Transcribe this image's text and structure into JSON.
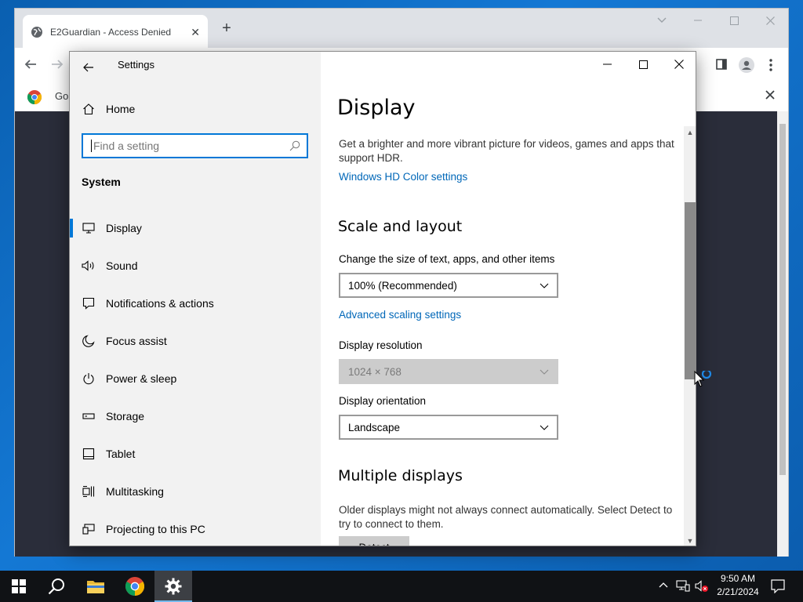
{
  "browser": {
    "tab_title": "E2Guardian - Access Denied",
    "bookmark_text": "Go"
  },
  "settings": {
    "window_title": "Settings",
    "home_label": "Home",
    "search_placeholder": "Find a setting",
    "section_label": "System",
    "nav_items": [
      {
        "label": "Display",
        "icon": "monitor-icon",
        "active": true
      },
      {
        "label": "Sound",
        "icon": "speaker-icon",
        "active": false
      },
      {
        "label": "Notifications & actions",
        "icon": "notification-icon",
        "active": false
      },
      {
        "label": "Focus assist",
        "icon": "moon-icon",
        "active": false
      },
      {
        "label": "Power & sleep",
        "icon": "power-icon",
        "active": false
      },
      {
        "label": "Storage",
        "icon": "storage-icon",
        "active": false
      },
      {
        "label": "Tablet",
        "icon": "tablet-icon",
        "active": false
      },
      {
        "label": "Multitasking",
        "icon": "multitasking-icon",
        "active": false
      },
      {
        "label": "Projecting to this PC",
        "icon": "projecting-icon",
        "active": false
      }
    ],
    "main": {
      "title": "Display",
      "hdr_text": "Get a brighter and more vibrant picture for videos, games and apps that support HDR.",
      "hdr_link": "Windows HD Color settings",
      "scale_heading": "Scale and layout",
      "scale_label": "Change the size of text, apps, and other items",
      "scale_value": "100% (Recommended)",
      "advanced_link": "Advanced scaling settings",
      "resolution_label": "Display resolution",
      "resolution_value": "1024 × 768",
      "orientation_label": "Display orientation",
      "orientation_value": "Landscape",
      "multiple_heading": "Multiple displays",
      "multiple_text": "Older displays might not always connect automatically. Select Detect to try to connect to them.",
      "detect_button": "Detect"
    }
  },
  "taskbar": {
    "time": "9:50 AM",
    "date": "2/21/2024"
  },
  "colors": {
    "accent": "#0078d7",
    "link": "#0067b8",
    "taskbar": "#101215"
  }
}
